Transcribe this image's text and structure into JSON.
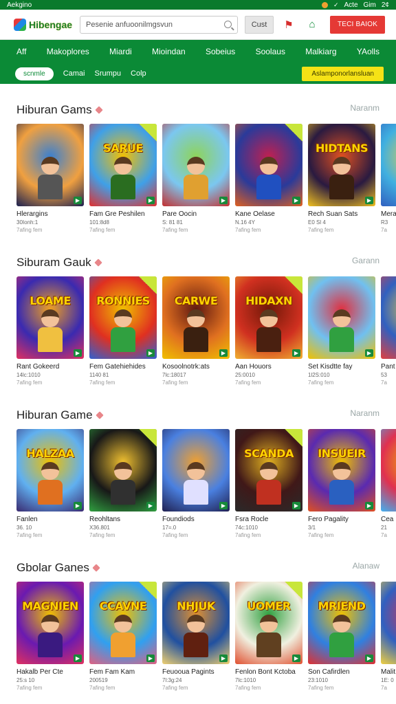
{
  "status": {
    "left": "Aekgino",
    "right1": "Acte",
    "right2": "Gim",
    "right3": "2¢"
  },
  "header": {
    "logo_text": "Hibengae",
    "search_placeholder": "Pesenie anfuoonilmgsvun",
    "cust_label": "Cust",
    "cta_label": "TECI BAIOK"
  },
  "nav": {
    "items": [
      "Aff",
      "Makoplores",
      "Miardi",
      "Mioindan",
      "Sobeius",
      "Soolaus",
      "Malkiarg",
      "YAolls"
    ],
    "pill": "scnmle",
    "subs": [
      "Camai",
      "Srumpu",
      "Colp"
    ],
    "yellow_btn": "Aslamponorlansluan"
  },
  "colors": {
    "brand_green": "#0b8a36",
    "cta_red": "#e53935",
    "promo_yellow": "#f5e216"
  },
  "sections": [
    {
      "title": "Hiburan Gams",
      "more": "Naranm",
      "cards": [
        {
          "art": "a1",
          "overlay": "",
          "title": "Hlerargins",
          "meta": "30Ionh:1",
          "sub": "7afing fem"
        },
        {
          "art": "a2",
          "overlay": "SARUE",
          "title": "Fam Gre Peshilen",
          "meta": "101:8d8",
          "sub": "7afing fem"
        },
        {
          "art": "a3",
          "overlay": "",
          "title": "Pare Oocin",
          "meta": "S: 81 81",
          "sub": "7afing fem"
        },
        {
          "art": "a4",
          "overlay": "",
          "title": "Kane Oelase",
          "meta": "N.16 4Y",
          "sub": "7afing fem"
        },
        {
          "art": "a5",
          "overlay": "HIDTANS",
          "title": "Rech Suan Sats",
          "meta": "E0 Sl 4",
          "sub": "7afing fem"
        },
        {
          "art": "a6",
          "overlay": "",
          "title": "Mera",
          "meta": "R3",
          "sub": "7a"
        }
      ]
    },
    {
      "title": "Siburam Gauk",
      "more": "Garann",
      "cards": [
        {
          "art": "b1",
          "overlay": "LOAME",
          "title": "Rant Gokeerd",
          "meta": "14lc:1010",
          "sub": "7afing fem"
        },
        {
          "art": "b2",
          "overlay": "RONNIES",
          "title": "Fem Gatehiehides",
          "meta": "1140 81",
          "sub": "7afing fem"
        },
        {
          "art": "b3",
          "overlay": "CARWE",
          "title": "Kosoolnotrk:ats",
          "meta": "7lc:18017",
          "sub": "7afing fem"
        },
        {
          "art": "b4",
          "overlay": "HIDAXN",
          "title": "Aan Houors",
          "meta": "25:0010",
          "sub": "7afing fem"
        },
        {
          "art": "b5",
          "overlay": "",
          "title": "Set Kisdtte fay",
          "meta": "1l2S:010",
          "sub": "7afing fem"
        },
        {
          "art": "b6",
          "overlay": "",
          "title": "Pant",
          "meta": "53",
          "sub": "7a"
        }
      ]
    },
    {
      "title": "Hiburan Game",
      "more": "Naranm",
      "cards": [
        {
          "art": "c1",
          "overlay": "HALZAA",
          "title": "Fanlen",
          "meta": "36. 10",
          "sub": "7afing fem"
        },
        {
          "art": "c2",
          "overlay": "",
          "title": "Reohltans",
          "meta": "X36.801",
          "sub": "7afing fem"
        },
        {
          "art": "c3",
          "overlay": "",
          "title": "Foundiods",
          "meta": "17=.0",
          "sub": "7afing fem"
        },
        {
          "art": "c4",
          "overlay": "SCANDA",
          "title": "Fsra Rocle",
          "meta": "74c:1010",
          "sub": "7afing fem"
        },
        {
          "art": "c5",
          "overlay": "INSUEIR",
          "title": "Fero Pagality",
          "meta": "3/1",
          "sub": "7afing fem"
        },
        {
          "art": "c6",
          "overlay": "",
          "title": "Cea",
          "meta": "21",
          "sub": "7a"
        }
      ]
    },
    {
      "title": "Gbolar Ganes",
      "more": "Alanaw",
      "cards": [
        {
          "art": "d1",
          "overlay": "MAGNIEN",
          "title": "Hakalb Per Cte",
          "meta": "25:s 10",
          "sub": "7afing fem"
        },
        {
          "art": "d2",
          "overlay": "CCAVNE",
          "title": "Fem Fam Kam",
          "meta": "200519",
          "sub": "7afing fem"
        },
        {
          "art": "d3",
          "overlay": "NHJUK",
          "title": "Feuooua Pagints",
          "meta": "7l:3g:24",
          "sub": "7afing fem"
        },
        {
          "art": "d4",
          "overlay": "UOMER",
          "title": "Fenlon Bont Kctoba",
          "meta": "7lc:1010",
          "sub": "7afing fem"
        },
        {
          "art": "d5",
          "overlay": "MRIEND",
          "title": "Son Cafirdlen",
          "meta": "23:1010",
          "sub": "7afing fem"
        },
        {
          "art": "d6",
          "overlay": "",
          "title": "Malit",
          "meta": "1E: 0",
          "sub": "7a"
        }
      ]
    }
  ]
}
